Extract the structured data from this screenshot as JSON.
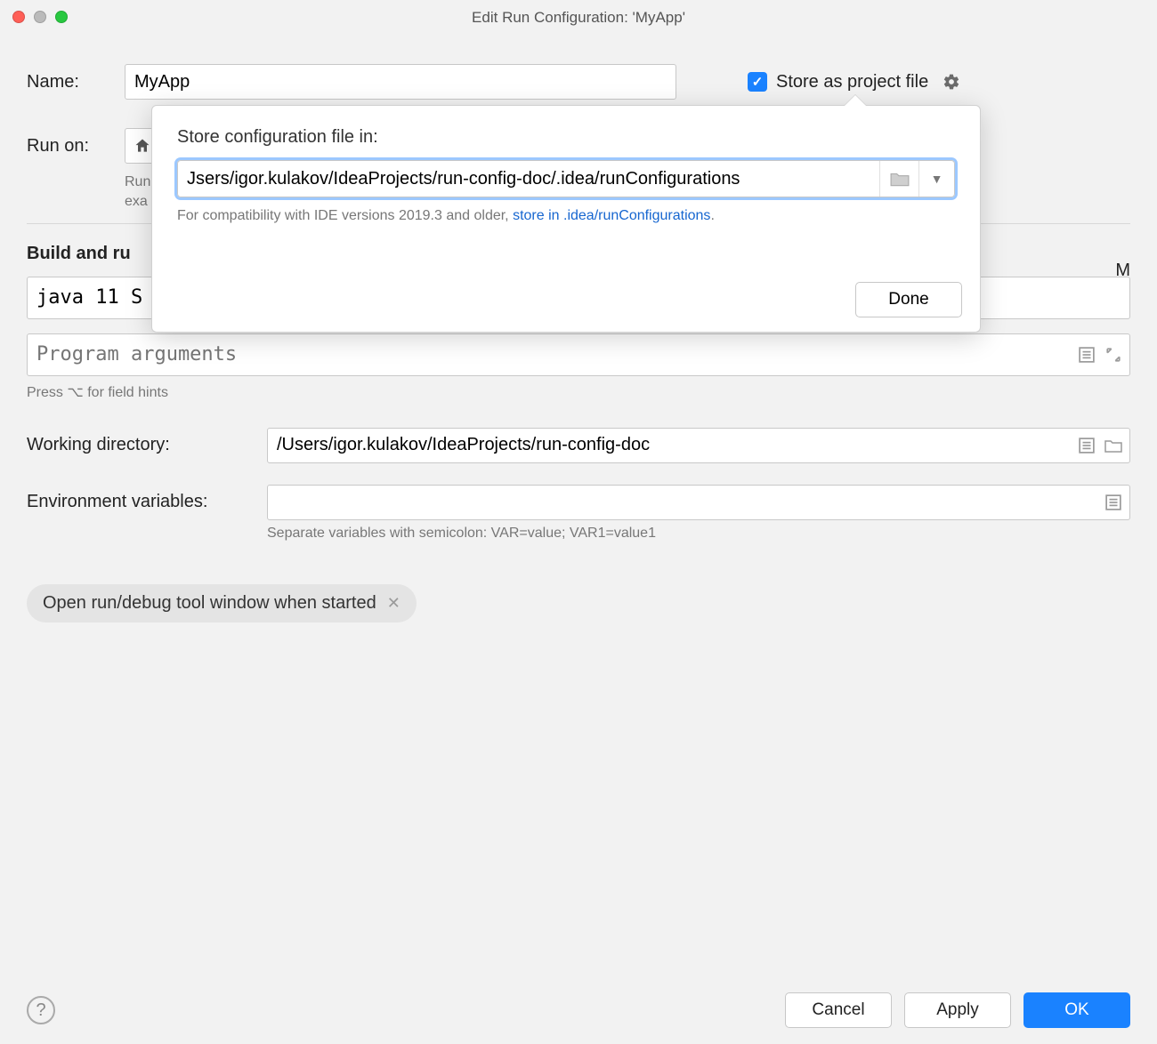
{
  "window": {
    "title": "Edit Run Configuration: 'MyApp'"
  },
  "fields": {
    "name_label": "Name:",
    "name_value": "MyApp",
    "store_label": "Store as project file",
    "run_on_label": "Run on:",
    "run_hint_line1": "Run",
    "run_hint_line2": "exa",
    "vm_suffix": "M",
    "java_value": "java 11 S",
    "program_args_placeholder": "Program arguments",
    "press_hint": "Press ⌥ for field hints",
    "working_dir_label": "Working directory:",
    "working_dir_value": "/Users/igor.kulakov/IdeaProjects/run-config-doc",
    "env_label": "Environment variables:",
    "env_hint": "Separate variables with semicolon: VAR=value; VAR1=value1",
    "chip_label": "Open run/debug tool window when started"
  },
  "sections": {
    "build_and_run": "Build and ru"
  },
  "popover": {
    "title": "Store configuration file in:",
    "path": "Jsers/igor.kulakov/IdeaProjects/run-config-doc/.idea/runConfigurations",
    "hint_prefix": "For compatibility with IDE versions 2019.3 and older, ",
    "hint_link": "store in .idea/runConfigurations",
    "hint_suffix": ".",
    "done": "Done"
  },
  "footer": {
    "cancel": "Cancel",
    "apply": "Apply",
    "ok": "OK"
  }
}
